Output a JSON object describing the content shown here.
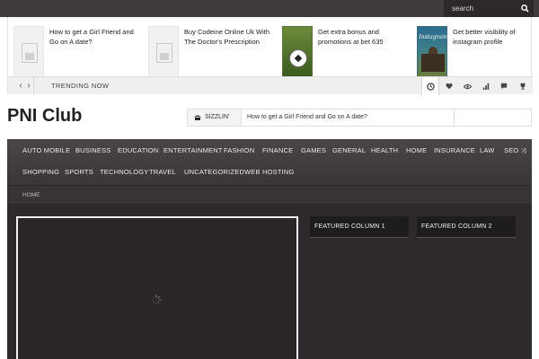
{
  "topbar": {
    "search_placeholder": "search"
  },
  "trending": {
    "items": [
      {
        "title": "How to get a Girl Friend and Go on A date?",
        "thumb": "placeholder"
      },
      {
        "title": "Buy Codeine Online Uk With The Doctor's Prescription",
        "thumb": "placeholder"
      },
      {
        "title": "Get extra bonus and promotions at bet 635",
        "thumb": "soccer-ball-photo"
      },
      {
        "title": "Get better visibility of instagram profile",
        "thumb": "instagram-photo"
      }
    ],
    "label": "TRENDING NOW",
    "thumb_logo_text": "Instagram",
    "tab_icons": [
      "clock-icon",
      "heart-icon",
      "eye-icon",
      "bar-chart-icon",
      "comment-icon",
      "trophy-icon"
    ]
  },
  "header": {
    "site_title": "PNI Club",
    "ticker_label": "SIZZLIN'",
    "ticker_text": "How to get a Girl Friend and Go on A date?"
  },
  "nav": {
    "row1": [
      "AUTO MOBILE",
      "BUSINESS",
      "EDUCATION",
      "ENTERTAINMENT",
      "FASHION",
      "FINANCE",
      "GAMES",
      "GENERAL",
      "HEALTH",
      "HOME",
      "INSURANCE",
      "LAW",
      "SEO"
    ],
    "row2": [
      "SHOPPING",
      "SPORTS",
      "TECHNOLOGY",
      "TRAVEL",
      "UNCATEGORIZED",
      "WEB HOSTING"
    ]
  },
  "breadcrumb": {
    "home": "HOME"
  },
  "featured": {
    "col1": "FEATURED COLUMN 1",
    "col2": "FEATURED COLUMN 2"
  },
  "colors": {
    "topbar_bg": "#3f3a3e",
    "frame_bg": "#2c282b",
    "accent_blue": "#5b6fb0"
  }
}
